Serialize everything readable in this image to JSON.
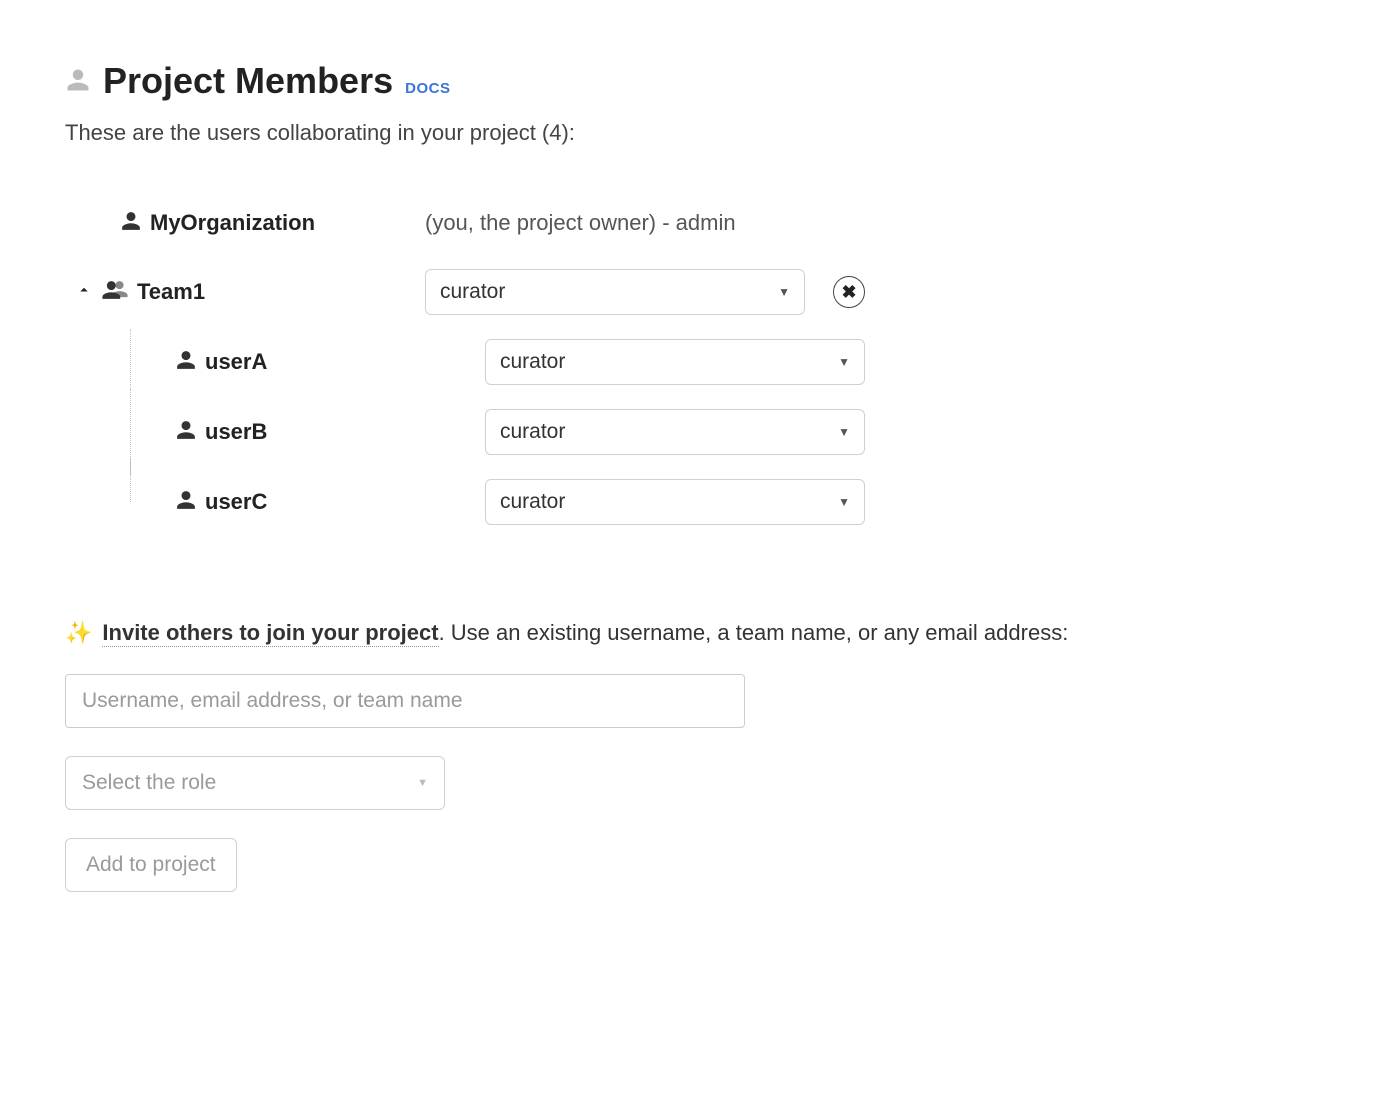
{
  "header": {
    "title": "Project Members",
    "docs_label": "DOCS"
  },
  "subtitle": "These are the users collaborating in your project (4):",
  "owner": {
    "name": "MyOrganization",
    "note": "(you, the project owner) - admin"
  },
  "team": {
    "name": "Team1",
    "role": "curator"
  },
  "team_members": [
    {
      "name": "userA",
      "role": "curator"
    },
    {
      "name": "userB",
      "role": "curator"
    },
    {
      "name": "userC",
      "role": "curator"
    }
  ],
  "invite": {
    "strong": "Invite others to join your project",
    "rest": ". Use an existing username, a team name, or any email address:",
    "input_placeholder": "Username, email address, or team name",
    "role_placeholder": "Select the role",
    "button_label": "Add to project"
  }
}
